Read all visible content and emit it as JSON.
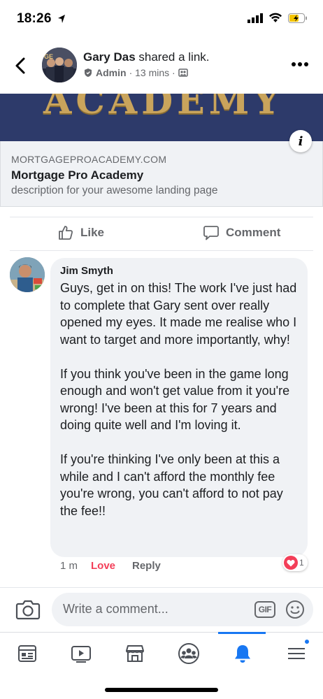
{
  "status_bar": {
    "time": "18:26"
  },
  "header": {
    "author_name": "Gary Das",
    "action_text": " shared a link.",
    "role": "Admin",
    "time": "· 13 mins ·"
  },
  "link_preview": {
    "banner_text": "ACADEMY",
    "domain": "MORTGAGEPROACADEMY.COM",
    "title": "Mortgage Pro Academy",
    "description": "description for your awesome landing page"
  },
  "actions": {
    "like_label": "Like",
    "comment_label": "Comment"
  },
  "comment": {
    "author": "Jim Smyth",
    "text": "Guys, get in on this! The work I've just had to complete that Gary sent over really opened my eyes. It made me realise who I want to target and more importantly, why!\n\nIf you think you've been in the game long enough and won't get value from it you're wrong! I've been at this for 7 years and doing quite well and I'm loving it.\n\nIf you're thinking I've only been at this a while and I can't afford the monthly fee you're wrong, you can't afford to not pay the fee!!",
    "time": "1 m",
    "reaction_label": "Love",
    "reply_label": "Reply",
    "reaction_count": "1"
  },
  "composer": {
    "placeholder": "Write a comment...",
    "gif_label": "GIF"
  },
  "tab_bar": {
    "tabs": [
      "news-feed-icon",
      "watch-icon",
      "marketplace-icon",
      "groups-icon",
      "notifications-icon",
      "menu-icon"
    ],
    "active_tab": "notifications-icon",
    "accent_color": "#1877f2"
  },
  "colors": {
    "banner": "#2d3a6a",
    "love": "#f33e58",
    "accent": "#1877f2"
  }
}
